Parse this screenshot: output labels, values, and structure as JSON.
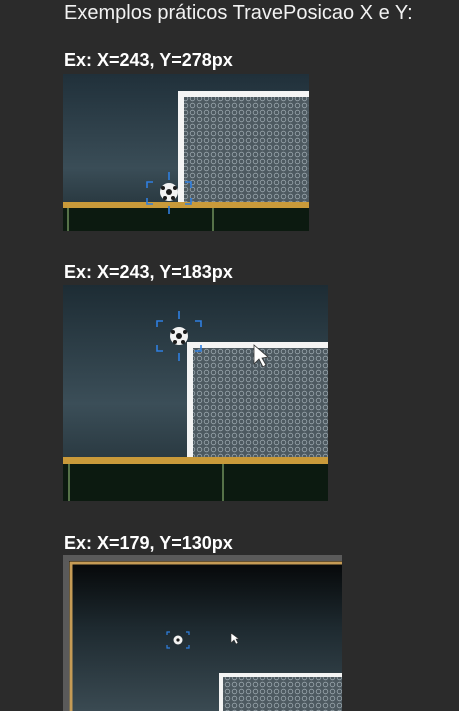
{
  "page": {
    "title": "Exemplos práticos TravePosicao X e Y:"
  },
  "examples": [
    {
      "label": "Ex: X=243, Y=278px"
    },
    {
      "label": "Ex: X=243, Y=183px"
    },
    {
      "label": "Ex: X=179, Y=130px"
    }
  ],
  "colors": {
    "background": "#2b2b2b",
    "goal_post": "#ffffff",
    "ground_line": "#c99a3a",
    "crosshair": "#2f7fe0",
    "net": "#7d8a93",
    "frame_border": "#c59b55"
  },
  "icons": {
    "ball": "soccer-ball-icon",
    "crosshair": "crosshair-icon",
    "cursor": "mouse-pointer-icon"
  }
}
